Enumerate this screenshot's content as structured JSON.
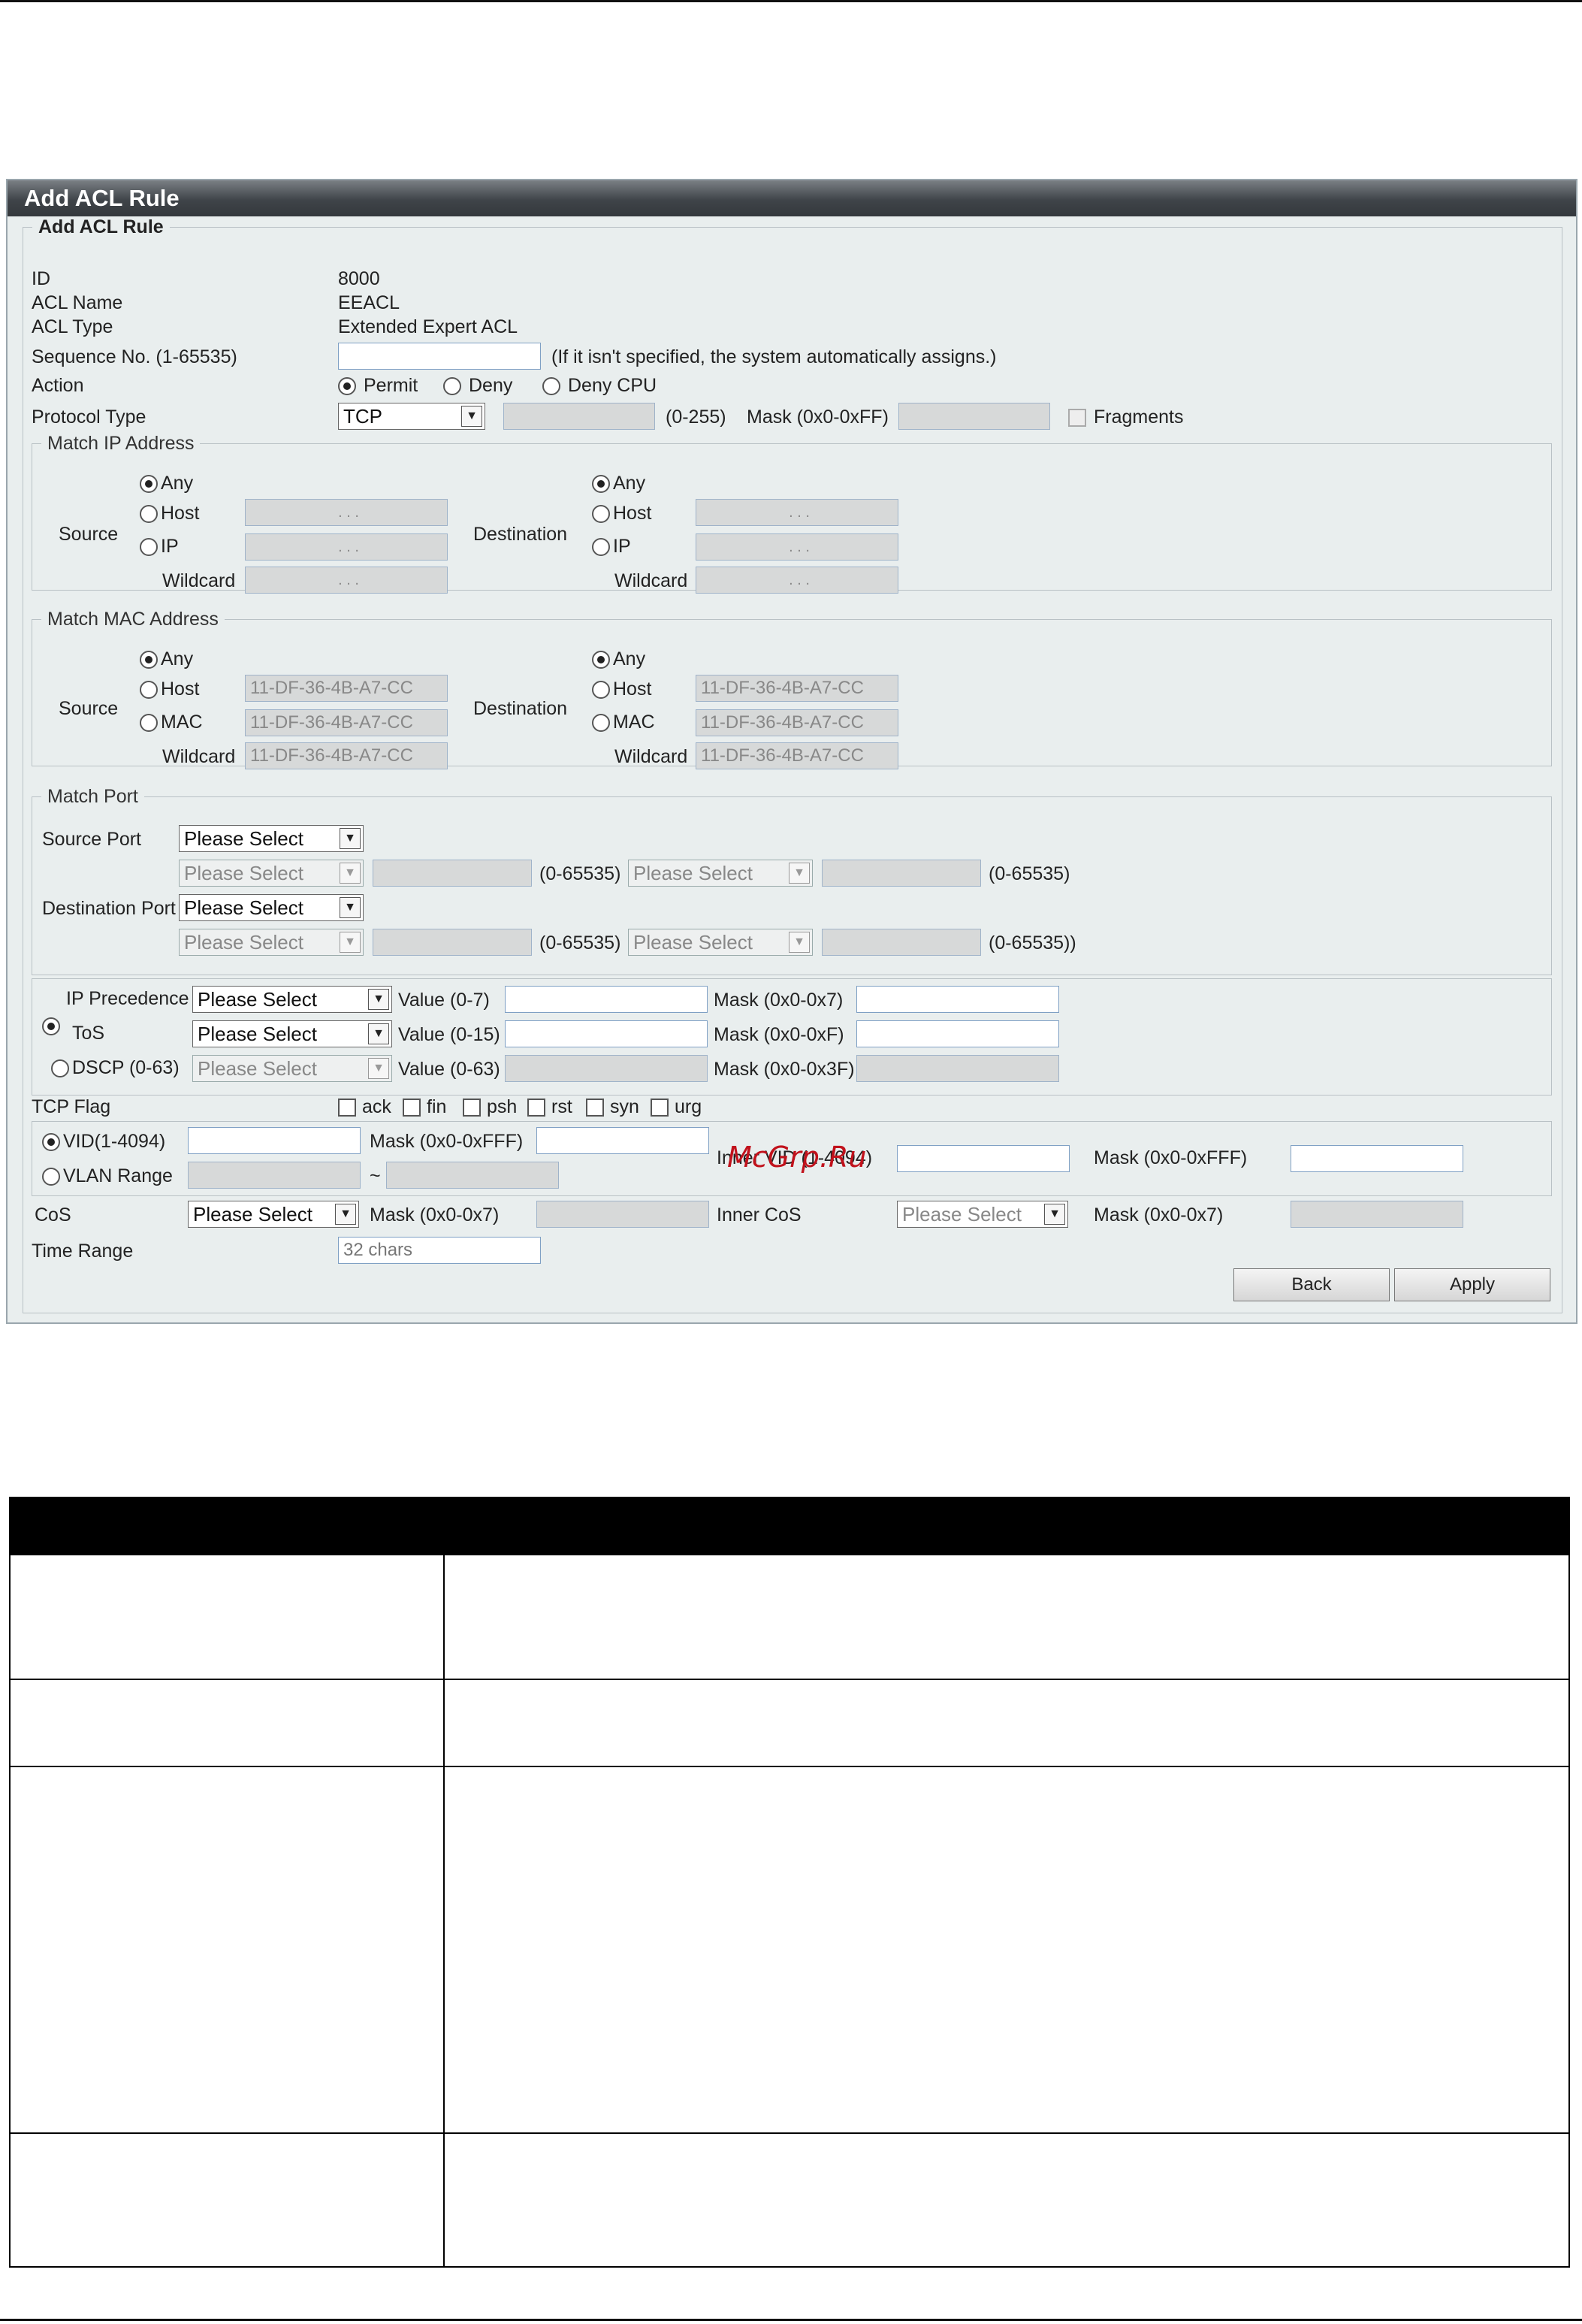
{
  "panel": {
    "title": "Add ACL Rule",
    "section_title": "Add ACL Rule"
  },
  "info": {
    "id_label": "ID",
    "id_value": "8000",
    "acl_name_label": "ACL Name",
    "acl_name_value": "EEACL",
    "acl_type_label": "ACL Type",
    "acl_type_value": "Extended Expert ACL"
  },
  "sequence": {
    "label": "Sequence No. (1-65535)",
    "value": "",
    "hint": "(If it isn't specified, the system automatically assigns.)"
  },
  "action": {
    "label": "Action",
    "options": [
      "Permit",
      "Deny",
      "Deny CPU"
    ],
    "selected": "Permit"
  },
  "protocol": {
    "label": "Protocol Type",
    "selected": "TCP",
    "range_hint": "(0-255)",
    "mask_label": "Mask (0x0-0xFF)",
    "fragments_label": "Fragments"
  },
  "match_ip": {
    "legend": "Match IP Address",
    "source_label": "Source",
    "destination_label": "Destination",
    "options": [
      "Any",
      "Host",
      "IP"
    ],
    "wildcard_label": "Wildcard",
    "selected": "Any",
    "ip_placeholder": ".      .      ."
  },
  "match_mac": {
    "legend": "Match MAC Address",
    "source_label": "Source",
    "destination_label": "Destination",
    "options": [
      "Any",
      "Host",
      "MAC"
    ],
    "wildcard_label": "Wildcard",
    "selected": "Any",
    "mac_placeholder": "11-DF-36-4B-A7-CC"
  },
  "match_port": {
    "legend": "Match Port",
    "source_label": "Source Port",
    "destination_label": "Destination Port",
    "select_placeholder": "Please Select",
    "range_hint": "(0-65535)",
    "range_hint_end": "(0-65535))"
  },
  "qos": {
    "ip_precedence_label": "IP Precedence",
    "tos_label": "ToS",
    "dscp_label": "DSCP (0-63)",
    "select_placeholder": "Please Select",
    "value_07": "Value (0-7)",
    "value_015": "Value (0-15)",
    "value_063": "Value (0-63)",
    "mask_07": "Mask (0x0-0x7)",
    "mask_0f": "Mask (0x0-0xF)",
    "mask_3f": "Mask (0x0-0x3F)"
  },
  "tcp_flag": {
    "label": "TCP Flag",
    "flags": [
      "ack",
      "fin",
      "psh",
      "rst",
      "syn",
      "urg"
    ]
  },
  "vlan": {
    "vid_label": "VID(1-4094)",
    "vid_mask_label": "Mask (0x0-0xFFF)",
    "range_label": "VLAN Range",
    "tilde": "~",
    "inner_vid_label": "Inner VID (1-4094)",
    "inner_mask_label": "Mask (0x0-0xFFF)"
  },
  "cos": {
    "label": "CoS",
    "select_placeholder": "Please Select",
    "mask_label": "Mask (0x0-0x7)",
    "inner_label": "Inner CoS",
    "inner_select_placeholder": "Please Select",
    "inner_mask_label": "Mask (0x0-0x7)"
  },
  "time_range": {
    "label": "Time Range",
    "placeholder": "32 chars"
  },
  "buttons": {
    "back": "Back",
    "apply": "Apply"
  },
  "watermark": "McGrp.Ru"
}
